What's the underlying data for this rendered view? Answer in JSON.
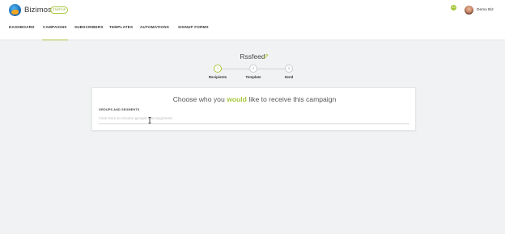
{
  "app": {
    "brand_name": "Bizimos",
    "plan_badge": "STARTUP"
  },
  "nav": {
    "items": [
      {
        "label": "DASHBOARD",
        "active": false
      },
      {
        "label": "CAMPAIGNS",
        "active": true
      },
      {
        "label": "SUBSCRIBERS",
        "active": false
      },
      {
        "label": "TEMPLATES",
        "active": false
      },
      {
        "label": "AUTOMATIONS",
        "active": false
      },
      {
        "label": "SIGNUP FORMS",
        "active": false
      }
    ]
  },
  "user": {
    "notification_count": "10",
    "name": "Demo Biz"
  },
  "campaign": {
    "title": "Rssfeed",
    "edit_icon": "pencil-icon"
  },
  "steps": [
    {
      "number": "1",
      "label": "Recipients",
      "active": true
    },
    {
      "number": "2",
      "label": "Template",
      "active": false
    },
    {
      "number": "3",
      "label": "Send",
      "active": false
    }
  ],
  "recipients_card": {
    "heading_before": "Choose who you ",
    "heading_highlight": "would",
    "heading_after": " like to receive this campaign",
    "field_label": "GROUPS AND SEGMENTS",
    "field_placeholder": "Click here to choose groups and segments",
    "field_value": ""
  },
  "colors": {
    "accent": "#a6c63c",
    "page_background": "#f1f2f3",
    "card_background": "#ffffff"
  }
}
